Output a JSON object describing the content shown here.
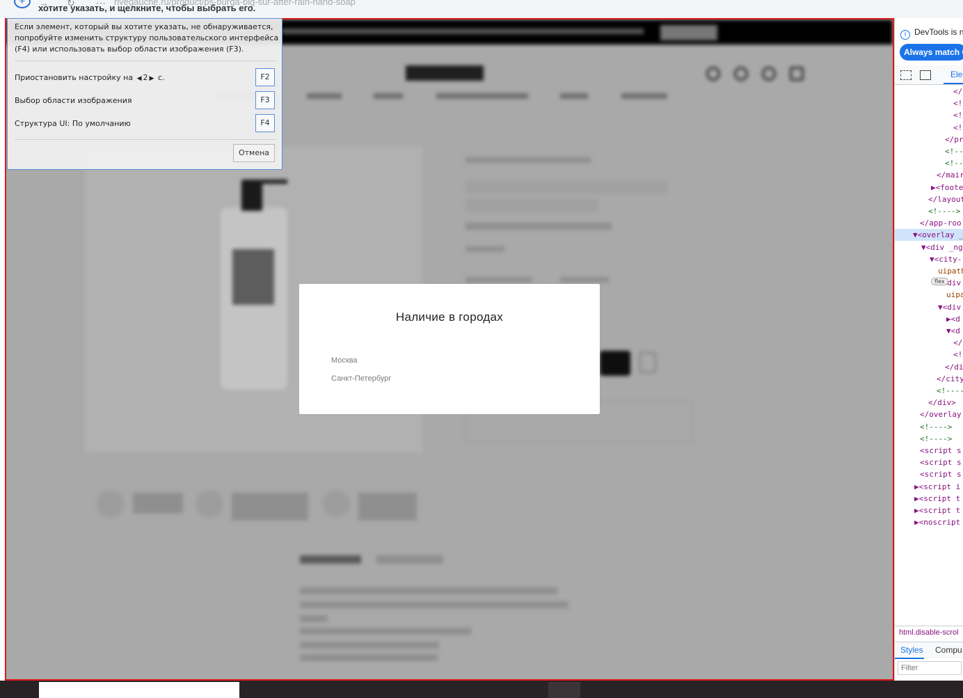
{
  "browser": {
    "url": "rivegauche.ru/product/ps-burga-big-sur-after-rain-hand-soap",
    "picker_hint": "хотите указать, и щелкните, чтобы выбрать его."
  },
  "modal": {
    "title": "Наличие в городах",
    "cities": [
      "Москва",
      "Санкт-Петербург"
    ]
  },
  "snipping": {
    "description": "Если элемент, который вы хотите указать, не обнаруживается, попробуйте изменить структуру пользовательского интерфейса (F4) или использовать выбор области изображения (F3).",
    "pause_label": "Приостановить настройку на",
    "pause_value": "2",
    "pause_unit": "с.",
    "pause_key": "F2",
    "region_label": "Выбор области изображения",
    "region_key": "F3",
    "ui_label": "Структура UI:  По умолчанию",
    "ui_key": "F4",
    "cancel_label": "Отмена"
  },
  "devtools": {
    "info_text": "DevTools is n",
    "match_button": "Always match C",
    "elements_tab": "Elem",
    "code_lines": [
      {
        "indent": 84,
        "text": "</",
        "kind": "tag"
      },
      {
        "indent": 84,
        "text": "<!",
        "kind": "tag"
      },
      {
        "indent": 84,
        "text": "<!",
        "kind": "tag"
      },
      {
        "indent": 84,
        "text": "<!",
        "kind": "tag"
      },
      {
        "indent": 72,
        "text": "</pr",
        "kind": "tag"
      },
      {
        "indent": 72,
        "text": "<!--",
        "kind": "cm"
      },
      {
        "indent": 72,
        "text": "<!--",
        "kind": "cm"
      },
      {
        "indent": 60,
        "text": "</mair",
        "kind": "tag"
      },
      {
        "indent": 52,
        "text": "▶<foote",
        "kind": "tag"
      },
      {
        "indent": 48,
        "text": "</layout",
        "kind": "tag"
      },
      {
        "indent": 48,
        "text": "<!---->",
        "kind": "cm"
      },
      {
        "indent": 36,
        "text": "</app-roo",
        "kind": "tag"
      },
      {
        "indent": 0,
        "text": "▼<overlay _",
        "kind": "sel"
      },
      {
        "indent": 38,
        "text": "▼<div _ng",
        "kind": "tag"
      },
      {
        "indent": 50,
        "text": "▼<city-",
        "kind": "tag"
      },
      {
        "indent": 62,
        "text": "uipath",
        "kind": "attr"
      },
      {
        "indent": 62,
        "text": "▶<div",
        "kind": "tag"
      },
      {
        "indent": 74,
        "text": "uipa",
        "kind": "attr"
      },
      {
        "indent": 62,
        "text": "▼<div",
        "kind": "tag"
      },
      {
        "indent": 74,
        "text": "▶<d",
        "kind": "tag"
      },
      {
        "indent": 74,
        "text": "▼<d",
        "kind": "tag"
      },
      {
        "indent": 84,
        "text": "</",
        "kind": "tag"
      },
      {
        "indent": 84,
        "text": "<!",
        "kind": "tag"
      },
      {
        "indent": 72,
        "text": "</di",
        "kind": "tag"
      },
      {
        "indent": 60,
        "text": "</city",
        "kind": "tag"
      },
      {
        "indent": 60,
        "text": "<!----",
        "kind": "cm"
      },
      {
        "indent": 48,
        "text": "</div>",
        "kind": "tag"
      },
      {
        "indent": 36,
        "text": "</overlay",
        "kind": "tag"
      },
      {
        "indent": 36,
        "text": "<!---->",
        "kind": "cm"
      },
      {
        "indent": 36,
        "text": "<!---->",
        "kind": "cm"
      },
      {
        "indent": 36,
        "text": "<script s",
        "kind": "tag"
      },
      {
        "indent": 36,
        "text": "<script s",
        "kind": "tag"
      },
      {
        "indent": 36,
        "text": "<script s",
        "kind": "tag"
      },
      {
        "indent": 28,
        "text": "▶<script i",
        "kind": "tag"
      },
      {
        "indent": 28,
        "text": "▶<script t",
        "kind": "tag"
      },
      {
        "indent": 28,
        "text": "▶<script t",
        "kind": "tag"
      },
      {
        "indent": 28,
        "text": "▶<noscript",
        "kind": "tag"
      }
    ],
    "flex_badge": "flex",
    "breadcrumb": "html.disable-scrol",
    "styles_tab": "Styles",
    "computed_tab": "Compu",
    "filter_placeholder": "Filter"
  },
  "colors": {
    "selection_border": "#e0171b",
    "picker_border": "#5b8fd6",
    "devtools_accent": "#1a73e8"
  }
}
